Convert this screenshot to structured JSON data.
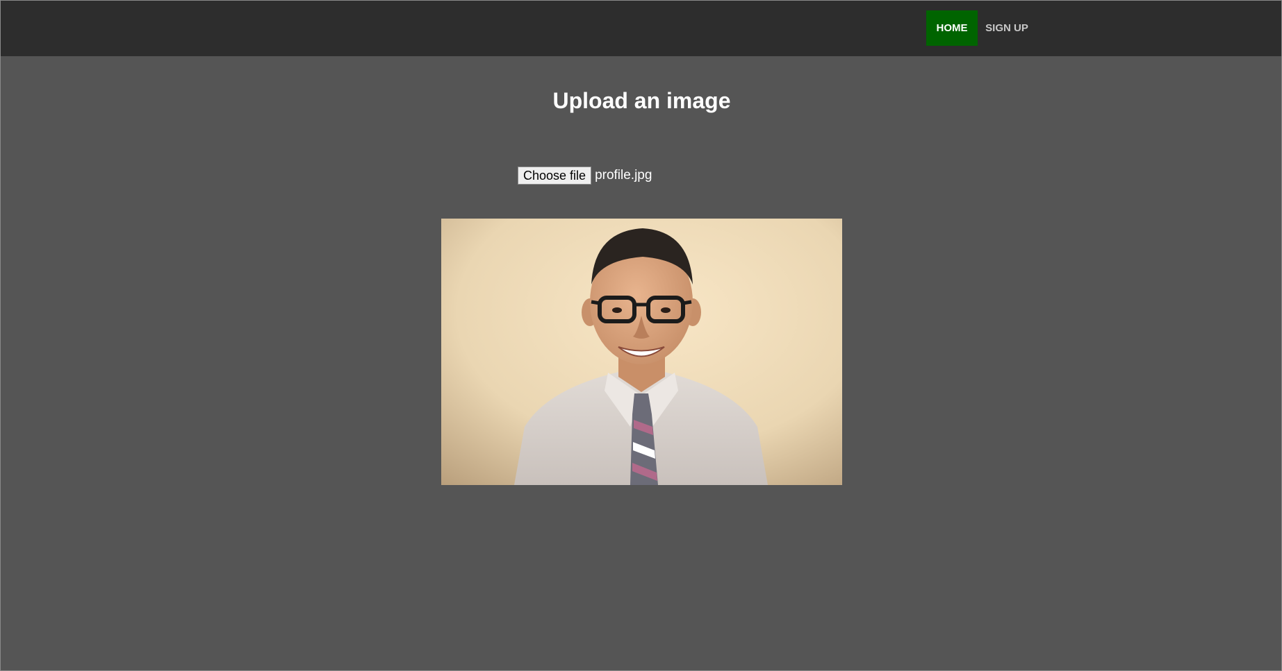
{
  "nav": {
    "home_label": "HOME",
    "signup_label": "SIGN UP",
    "active_color": "#006400",
    "bar_color": "#2d2d2d"
  },
  "page": {
    "title": "Upload an image",
    "background": "#555555"
  },
  "upload": {
    "button_label": "Choose file",
    "file_name": "profile.jpg"
  },
  "preview": {
    "icon": "profile-photo"
  }
}
